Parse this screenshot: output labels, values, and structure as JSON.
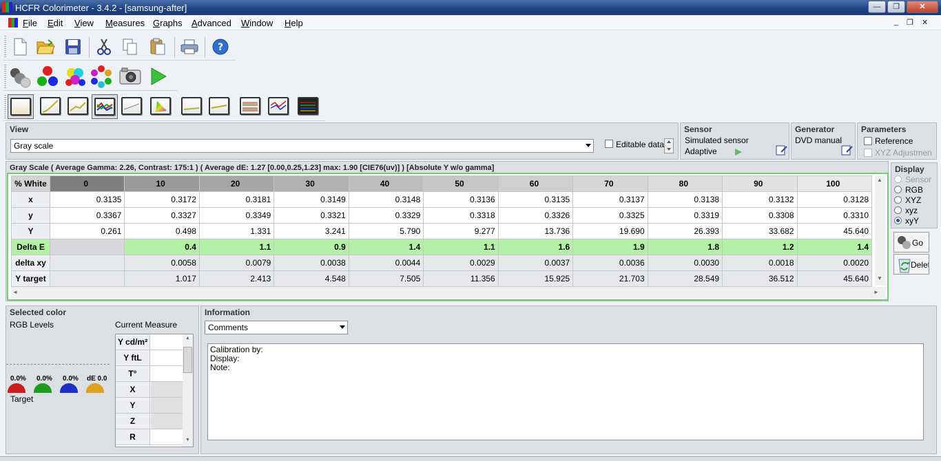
{
  "window": {
    "title": "HCFR Colorimeter - 3.4.2 - [samsung-after]",
    "min_glyph": "—",
    "max_glyph": "❐",
    "close_glyph": "✕"
  },
  "menu": {
    "items": [
      "File",
      "Edit",
      "View",
      "Measures",
      "Graphs",
      "Advanced",
      "Window",
      "Help"
    ],
    "mdi_min": "_",
    "mdi_restore": "❐",
    "mdi_close": "✕"
  },
  "toolbar": {
    "standard": [
      "new-document-icon",
      "open-folder-icon",
      "save-icon",
      "cut-icon",
      "copy-icon",
      "paste-icon",
      "print-icon",
      "help-icon"
    ],
    "measure": [
      "gray-measure-icon",
      "primaries-icon",
      "secondaries-icon",
      "color-circle-icon",
      "camera-icon",
      "play-icon"
    ],
    "views": [
      "grayscale-view-icon",
      "gamma-graph-icon",
      "luminance-graph-icon",
      "rgb-levels-graph-icon",
      "color-temp-graph-icon",
      "cie-diagram-icon",
      "delta-e-graph-icon",
      "saturation-graph-icon",
      "measures-graph-icon",
      "near-black-graph-icon",
      "multi-graph-icon"
    ]
  },
  "view_panel": {
    "title": "View",
    "selected": "Gray scale",
    "editable_label": "Editable data"
  },
  "sensor_panel": {
    "title": "Sensor",
    "line1": "Simulated sensor",
    "line2": "Adaptive"
  },
  "generator_panel": {
    "title": "Generator",
    "line1": "DVD manual"
  },
  "parameters_panel": {
    "title": "Parameters",
    "reference": "Reference",
    "xyz_adjust": "XYZ Adjustmen"
  },
  "grid": {
    "caption": "Gray Scale ( Average Gamma: 2.26, Contrast: 175:1 ) ( Average dE: 1.27 [0.00,0.25,1.23] max: 1.90 [CIE76(uv)] ) [Absolute Y w/o gamma]",
    "corner": "% White",
    "columns": [
      "0",
      "10",
      "20",
      "30",
      "40",
      "50",
      "60",
      "70",
      "80",
      "90",
      "100"
    ],
    "rows": [
      {
        "label": "x",
        "values": [
          "0.3135",
          "0.3172",
          "0.3181",
          "0.3149",
          "0.3148",
          "0.3136",
          "0.3135",
          "0.3137",
          "0.3138",
          "0.3132",
          "0.3128"
        ]
      },
      {
        "label": "y",
        "values": [
          "0.3367",
          "0.3327",
          "0.3349",
          "0.3321",
          "0.3329",
          "0.3318",
          "0.3326",
          "0.3325",
          "0.3319",
          "0.3308",
          "0.3310"
        ]
      },
      {
        "label": "Y",
        "values": [
          "0.261",
          "0.498",
          "1.331",
          "3.241",
          "5.790",
          "9.277",
          "13.736",
          "19.690",
          "26.393",
          "33.682",
          "45.640"
        ]
      },
      {
        "label": "Delta E",
        "values": [
          "",
          "0.4",
          "1.1",
          "0.9",
          "1.4",
          "1.1",
          "1.6",
          "1.9",
          "1.8",
          "1.2",
          "1.4"
        ]
      },
      {
        "label": "delta xy",
        "values": [
          "",
          "0.0058",
          "0.0079",
          "0.0038",
          "0.0044",
          "0.0029",
          "0.0037",
          "0.0036",
          "0.0030",
          "0.0018",
          "0.0020"
        ]
      },
      {
        "label": "Y target",
        "values": [
          "",
          "1.017",
          "2.413",
          "4.548",
          "7.505",
          "11.356",
          "15.925",
          "21.703",
          "28.549",
          "36.512",
          "45.640"
        ]
      }
    ]
  },
  "display_panel": {
    "title": "Display",
    "options": [
      "Sensor",
      "RGB",
      "XYZ",
      "xyz",
      "xyY"
    ],
    "selected": "xyY",
    "go_label": "Go",
    "delete_label": "Delet"
  },
  "selected_color": {
    "title": "Selected color",
    "rgb_levels": "RGB Levels",
    "current_measure": "Current Measure",
    "levels": [
      "0.0%",
      "0.0%",
      "0.0%",
      "dE 0.0"
    ],
    "level_colors": [
      "#c81e1e",
      "#1e9a1e",
      "#1e2ec8",
      "#e0a020"
    ],
    "target": "Target",
    "measure_rows": [
      "Y cd/m²",
      "Y ftL",
      "T°",
      "X",
      "Y",
      "Z",
      "R"
    ]
  },
  "information": {
    "title": "Information",
    "selected": "Comments",
    "lines": [
      "Calibration by:",
      "Display:",
      "Note:"
    ]
  },
  "arrows": {
    "up": "▲",
    "down": "▼",
    "left": "◄",
    "right": "►"
  }
}
